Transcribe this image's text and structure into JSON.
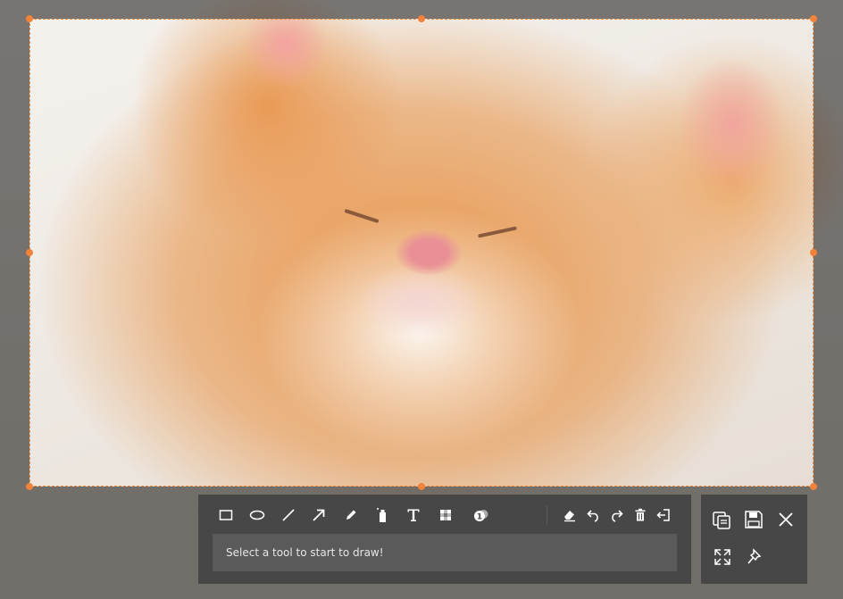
{
  "toolbar": {
    "tools": [
      {
        "name": "rectangle",
        "icon": "rectangle-icon"
      },
      {
        "name": "ellipse",
        "icon": "ellipse-icon"
      },
      {
        "name": "line",
        "icon": "line-icon"
      },
      {
        "name": "arrow",
        "icon": "arrow-icon"
      },
      {
        "name": "pencil",
        "icon": "pencil-icon"
      },
      {
        "name": "marker",
        "icon": "marker-icon"
      },
      {
        "name": "text",
        "icon": "text-icon"
      },
      {
        "name": "mosaic",
        "icon": "mosaic-icon"
      },
      {
        "name": "step-number",
        "icon": "step-number-icon"
      }
    ],
    "edit_tools": [
      {
        "name": "eraser",
        "icon": "eraser-icon"
      },
      {
        "name": "undo",
        "icon": "undo-icon"
      },
      {
        "name": "redo",
        "icon": "redo-icon"
      },
      {
        "name": "delete",
        "icon": "trash-icon"
      },
      {
        "name": "exit",
        "icon": "exit-icon"
      }
    ],
    "status_text": "Select a tool to start to draw!"
  },
  "actions": [
    {
      "name": "copy",
      "icon": "copy-icon"
    },
    {
      "name": "save",
      "icon": "save-icon"
    },
    {
      "name": "close",
      "icon": "close-icon"
    },
    {
      "name": "fullscreen",
      "icon": "expand-icon"
    },
    {
      "name": "pin",
      "icon": "pin-icon"
    }
  ],
  "colors": {
    "selection_border": "#f08a3c",
    "toolbar_bg": "#474747",
    "status_bg": "#5a5a5a",
    "icon": "#ffffff"
  }
}
